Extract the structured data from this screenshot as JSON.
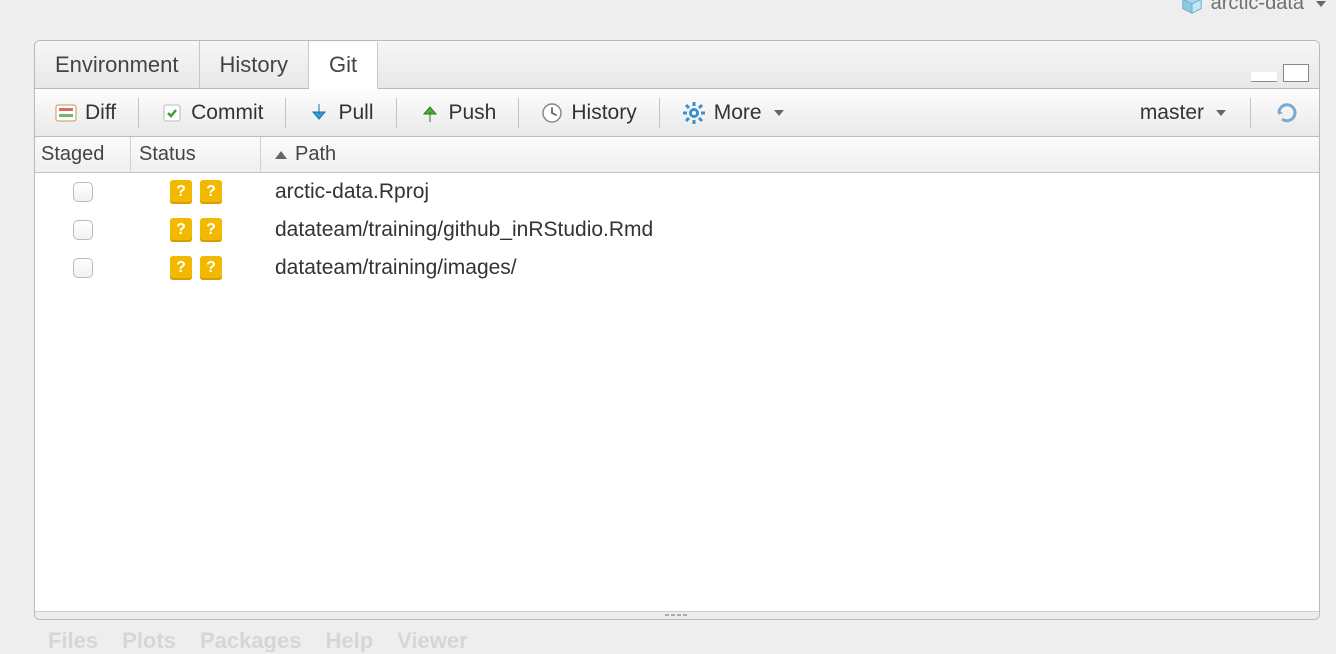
{
  "project_name": "arctic-data",
  "tabs": {
    "environment": "Environment",
    "history": "History",
    "git": "Git"
  },
  "toolbar": {
    "diff": "Diff",
    "commit": "Commit",
    "pull": "Pull",
    "push": "Push",
    "history": "History",
    "more": "More"
  },
  "branch": "master",
  "columns": {
    "staged": "Staged",
    "status": "Status",
    "path": "Path"
  },
  "files": [
    {
      "path": "arctic-data.Rproj"
    },
    {
      "path": "datateam/training/github_inRStudio.Rmd"
    },
    {
      "path": "datateam/training/images/"
    }
  ],
  "bottom_tabs": [
    "Files",
    "Plots",
    "Packages",
    "Help",
    "Viewer"
  ]
}
